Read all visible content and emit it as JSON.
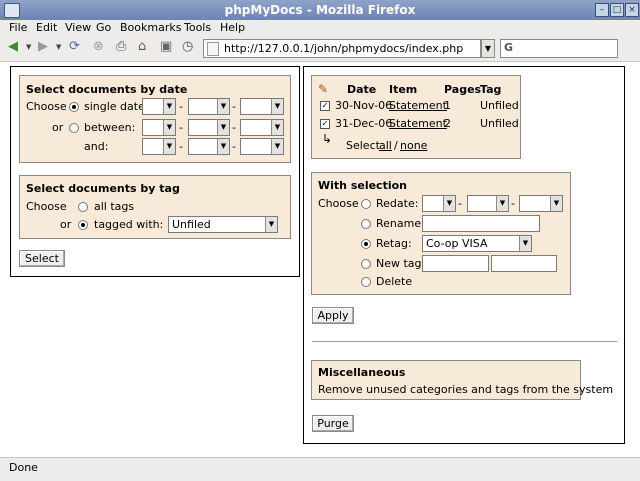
{
  "window": {
    "title": "phpMyDocs - Mozilla Firefox",
    "controls": [
      "–",
      "□",
      "×"
    ]
  },
  "menu": [
    "File",
    "Edit",
    "View",
    "Go",
    "Bookmarks",
    "Tools",
    "Help"
  ],
  "toolbar": {
    "url": "http://127.0.0.1/john/phpmydocs/index.php",
    "search_value": "",
    "icons": [
      "back-icon",
      "forward-icon",
      "reload-icon",
      "stop-icon",
      "print-icon",
      "home-icon",
      "history-icon"
    ]
  },
  "left": {
    "date_box": {
      "title": "Select documents by date",
      "choose": "Choose",
      "single_date": "single date:",
      "or": "or",
      "between": "between:",
      "and": "and:",
      "sep": "-"
    },
    "tag_box": {
      "title": "Select documents by tag",
      "choose": "Choose",
      "all_tags": "all tags",
      "or": "or",
      "tagged_with": "tagged with:",
      "tag_value": "Unfiled"
    },
    "select_button": "Select"
  },
  "right": {
    "table": {
      "headers": [
        "Date",
        "Item",
        "Pages",
        "Tag"
      ],
      "rows": [
        {
          "date": "30-Nov-06",
          "item": "Statement",
          "pages": "1",
          "tag": "Unfiled"
        },
        {
          "date": "31-Dec-06",
          "item": "Statement",
          "pages": "2",
          "tag": "Unfiled"
        }
      ],
      "select_label": "Select",
      "all": "all",
      "slash": "/",
      "none": "none"
    },
    "with_selection": {
      "title": "With selection",
      "choose": "Choose",
      "redate": "Redate:",
      "rename": "Rename:",
      "retag": "Retag:",
      "retag_value": "Co-op VISA",
      "new_tag": "New tag:",
      "delete": "Delete",
      "sep": "-"
    },
    "apply_button": "Apply",
    "misc": {
      "title": "Miscellaneous",
      "text": "Remove unused categories and tags from the system"
    },
    "purge_button": "Purge"
  },
  "status": "Done"
}
